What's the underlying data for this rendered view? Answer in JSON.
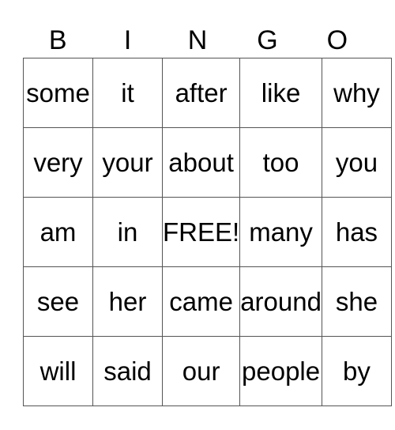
{
  "header": [
    "B",
    "I",
    "N",
    "G",
    "O"
  ],
  "rows": [
    [
      "some",
      "it",
      "after",
      "like",
      "why"
    ],
    [
      "very",
      "your",
      "about",
      "too",
      "you"
    ],
    [
      "am",
      "in",
      "FREE!",
      "many",
      "has"
    ],
    [
      "see",
      "her",
      "came",
      "around",
      "she"
    ],
    [
      "will",
      "said",
      "our",
      "people",
      "by"
    ]
  ]
}
